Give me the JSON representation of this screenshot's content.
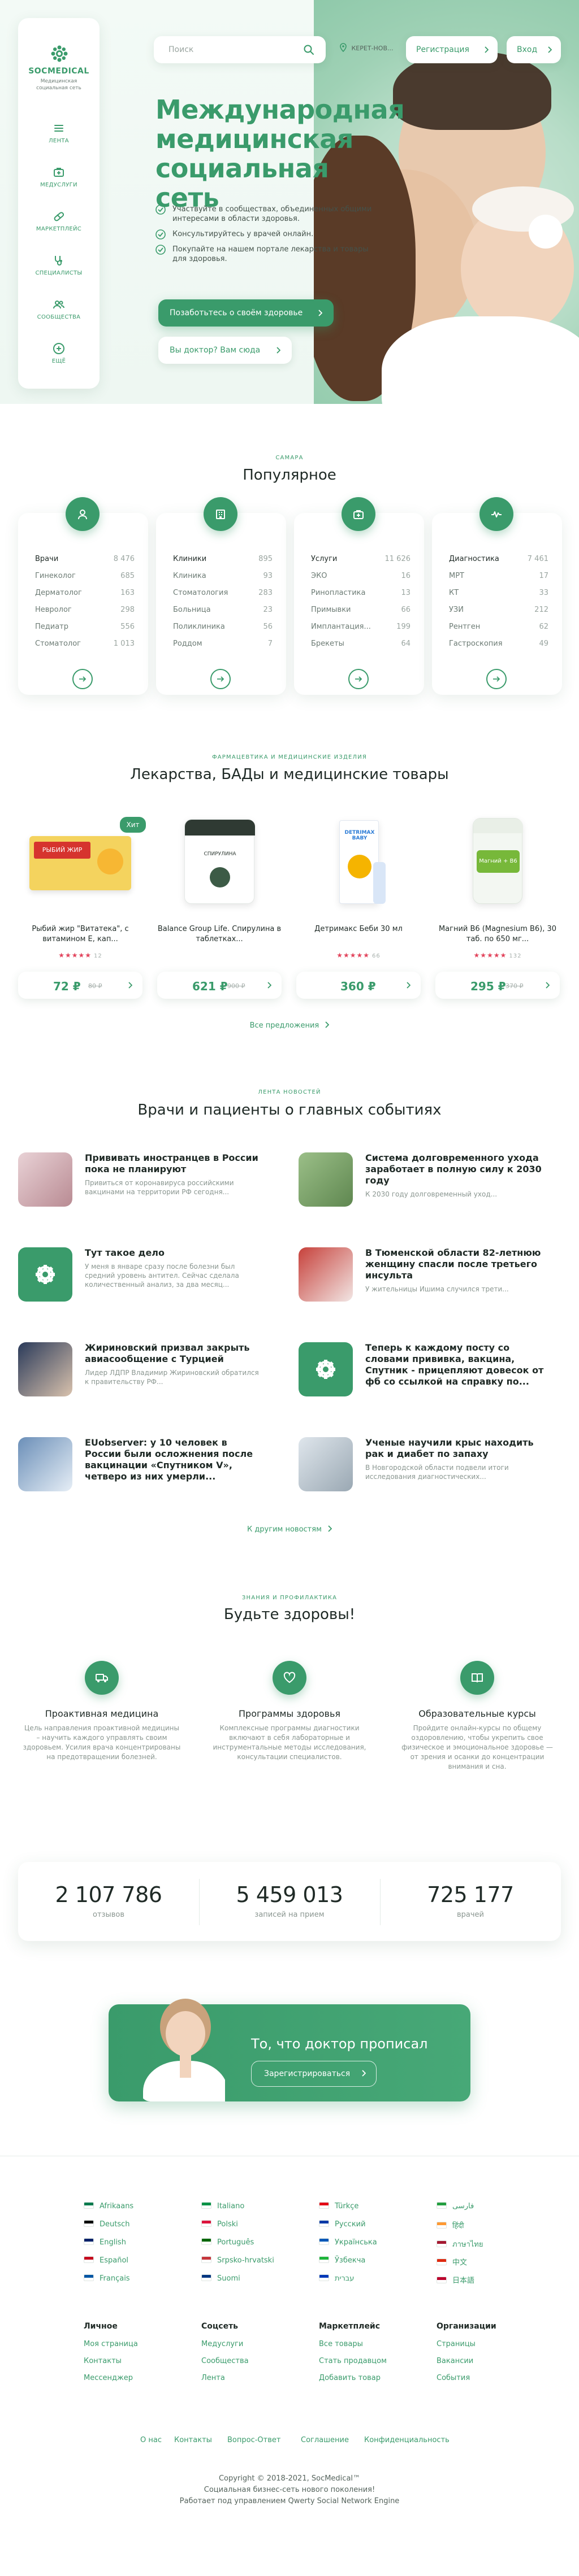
{
  "brand": {
    "name": "SOCMEDICAL",
    "tagline": "Медицинская социальная сеть"
  },
  "sidebar": {
    "items": [
      {
        "label": "ЛЕНТА",
        "icon": "list-icon"
      },
      {
        "label": "МЕДУСЛУГИ",
        "icon": "medkit-icon"
      },
      {
        "label": "МАРКЕТПЛЕЙС",
        "icon": "pill-icon"
      },
      {
        "label": "СПЕЦИАЛИСТЫ",
        "icon": "stethoscope-icon"
      },
      {
        "label": "СООБЩЕСТВА",
        "icon": "users-icon"
      },
      {
        "label": "ЕЩЁ",
        "icon": "plus-circle-icon"
      }
    ]
  },
  "header": {
    "search_placeholder": "Поиск",
    "location": "КЕРЕТ-НОВ...",
    "register_label": "Регистрация",
    "login_label": "Вход"
  },
  "hero": {
    "title": "Международная медицинская социальная сеть",
    "checks": [
      "Участвуйте в сообществах, объединенных общими интересами в области здоровья.",
      "Консультируйтесь у врачей онлайн.",
      "Покупайте на нашем портале лекарства и товары для здоровья."
    ],
    "cta_primary": "Позаботьтесь о своём здоровье",
    "cta_secondary": "Вы доктор? Вам сюда"
  },
  "popular": {
    "kicker": "САМАРА",
    "title": "Популярное",
    "cards": [
      {
        "icon": "user-icon",
        "rows": [
          [
            "Врачи",
            "8 476"
          ],
          [
            "Гинеколог",
            "685"
          ],
          [
            "Дерматолог",
            "163"
          ],
          [
            "Невролог",
            "298"
          ],
          [
            "Педиатр",
            "556"
          ],
          [
            "Стоматолог",
            "1 013"
          ]
        ]
      },
      {
        "icon": "building-icon",
        "rows": [
          [
            "Клиники",
            "895"
          ],
          [
            "Клиника",
            "93"
          ],
          [
            "Стоматология",
            "283"
          ],
          [
            "Больница",
            "23"
          ],
          [
            "Поликлиника",
            "56"
          ],
          [
            "Роддом",
            "7"
          ]
        ]
      },
      {
        "icon": "medkit-icon",
        "rows": [
          [
            "Услуги",
            "11 626"
          ],
          [
            "ЭКО",
            "16"
          ],
          [
            "Ринопластика",
            "13"
          ],
          [
            "Примывки",
            "66"
          ],
          [
            "Имплантация...",
            "199"
          ],
          [
            "Брекеты",
            "64"
          ]
        ]
      },
      {
        "icon": "pulse-icon",
        "rows": [
          [
            "Диагностика",
            "7 461"
          ],
          [
            "МРТ",
            "17"
          ],
          [
            "КТ",
            "33"
          ],
          [
            "УЗИ",
            "212"
          ],
          [
            "Рентген",
            "62"
          ],
          [
            "Гастроскопия",
            "49"
          ]
        ]
      }
    ]
  },
  "products": {
    "kicker": "ФАРМАЦЕВТИКА И МЕДИЦИНСКИЕ ИЗДЕЛИЯ",
    "title": "Лекарства, БАДы и медицинские товары",
    "hit_label": "Хит",
    "items": [
      {
        "name": "Рыбий жир \"Витатека\", с витамином Е, кап...",
        "stars": "★★★★★",
        "count": "12",
        "price": "72 ₽",
        "old": "80 ₽",
        "img_text": "РЫБИЙ ЖИР"
      },
      {
        "name": "Balance Group Life. Спирулина в таблетках...",
        "stars": "",
        "count": "",
        "price": "621 ₽",
        "old": "900 ₽",
        "img_text": "СПИРУЛИНА"
      },
      {
        "name": "Детримакс Беби 30 мл",
        "stars": "★★★★★",
        "count": "66",
        "price": "360 ₽",
        "old": "",
        "img_text": "DETRIMAX BABY"
      },
      {
        "name": "Магний B6 (Magnesium B6), 30 таб. по 650 мг...",
        "stars": "★★★★★",
        "count": "132",
        "price": "295 ₽",
        "old": "370 ₽",
        "img_text": "Магний + B6"
      }
    ],
    "more": "Все предложения"
  },
  "news": {
    "kicker": "ЛЕНТА НОВОСТЕЙ",
    "title": "Врачи и пациенты о главных событиях",
    "items": [
      {
        "title": "Прививать иностранцев в России пока не планируют",
        "desc": "Привиться от коронавируса российскими вакцинами на территории РФ сегодня..."
      },
      {
        "title": "Система долговременного ухода заработает в полную силу к 2030 году",
        "desc": "К 2030 году долговременный уход..."
      },
      {
        "title": "Тут такое дело",
        "desc": "У меня в январе сразу после болезни был средний уровень антител. Сейчас сделала количественный анализ, за два месяц..."
      },
      {
        "title": "В Тюменской области 82-летнюю женщину спасли после третьего инсульта",
        "desc": "У жительницы Ишима случился трети..."
      },
      {
        "title": "Жириновский призвал закрыть авиасообщение с Турцией",
        "desc": "Лидер ЛДПР Владимир Жириновский обратился к правительству РФ..."
      },
      {
        "title": "Теперь к каждому посту со словами прививка, вакцина, Спутник - прицепляют довесок от фб со ссылкой на справку по...",
        "desc": ""
      },
      {
        "title": "EUobserver: у 10 человек в России были осложнения после вакцинации «Спутником V», четверо из них умерли...",
        "desc": ""
      },
      {
        "title": "Ученые научили крыс находить рак и диабет по запаху",
        "desc": "В Новгородской области подвели итоги исследования диагностических..."
      }
    ],
    "more": "К другим новостям"
  },
  "health": {
    "kicker": "ЗНАНИЯ И ПРОФИЛАКТИКА",
    "title": "Будьте здоровы!",
    "items": [
      {
        "title": "Проактивная медицина",
        "desc": "Цель направления проактивной медицины – научить каждого управлять своим здоровьем. Усилия врача концентрированы на предотвращении болезней.",
        "icon": "truck-icon"
      },
      {
        "title": "Программы здоровья",
        "desc": "Комплексные программы диагностики включают в себя лабораторные и инструментальные методы исследования, консультации специалистов.",
        "icon": "heart-icon"
      },
      {
        "title": "Образовательные курсы",
        "desc": "Пройдите онлайн-курсы по общему оздоровлению, чтобы укрепить свое физическое и эмоциональное здоровье — от зрения и осанки до концентрации внимания и сна.",
        "icon": "book-icon"
      }
    ]
  },
  "stats": [
    {
      "value": "2 107 786",
      "label": "отзывов"
    },
    {
      "value": "5 459 013",
      "label": "записей на прием"
    },
    {
      "value": "725 177",
      "label": "врачей"
    }
  ],
  "banner": {
    "title": "То, что доктор прописал",
    "button": "Зарегистрироваться"
  },
  "languages": [
    [
      "Afrikaans",
      "Deutsch",
      "English",
      "Español",
      "Français"
    ],
    [
      "Italiano",
      "Polski",
      "Português",
      "Srpsko-hrvatski",
      "Suomi"
    ],
    [
      "Türkçe",
      "Русский",
      "Українська",
      "Ўзбекча",
      "עברית"
    ],
    [
      "فارسی",
      "हिंदी",
      "ภาษาไทย",
      "中文",
      "日本語"
    ]
  ],
  "footer_cols": [
    {
      "title": "Личное",
      "items": [
        "Моя страница",
        "Контакты",
        "Мессенджер"
      ]
    },
    {
      "title": "Соцсеть",
      "items": [
        "Медуслуги",
        "Сообщества",
        "Лента"
      ]
    },
    {
      "title": "Маркетплейс",
      "items": [
        "Все товары",
        "Стать продавцом",
        "Добавить товар"
      ]
    },
    {
      "title": "Организации",
      "items": [
        "Страницы",
        "Вакансии",
        "События"
      ]
    }
  ],
  "footer_links": [
    "О нас",
    "Контакты",
    "Вопрос-Ответ",
    "Соглашение",
    "Конфиденциальность"
  ],
  "copyright": [
    "Copyright © 2018-2021, SocMedical™",
    "Социальная бизнес-сеть нового поколения!",
    "Работает под управлением Qwerty Social Network Engine"
  ],
  "colors": {
    "accent": "#3a9b6b",
    "accent_light": "#eef7f2",
    "star": "#e2445c"
  }
}
